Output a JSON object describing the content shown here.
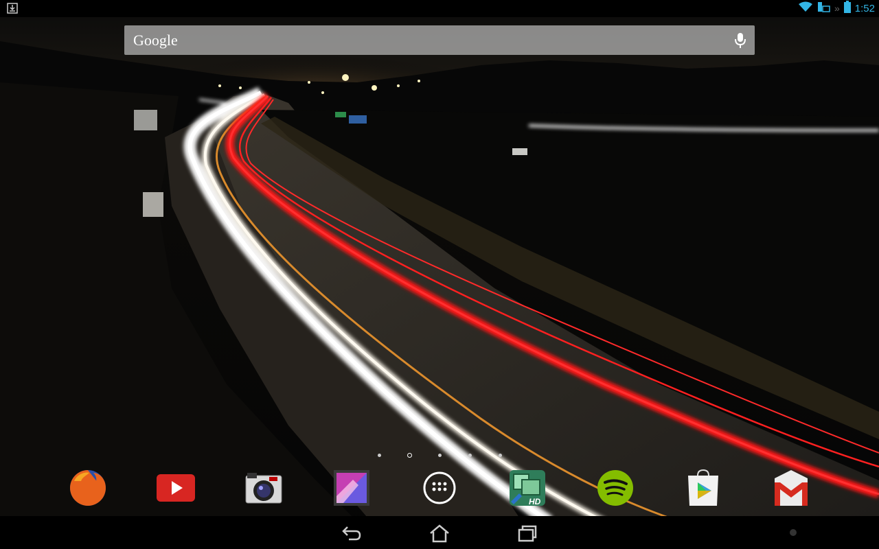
{
  "status_bar": {
    "time": "1:52",
    "icons": [
      "download-notification-icon",
      "wifi-icon",
      "keyboard-icon",
      "battery-icon"
    ]
  },
  "search": {
    "logo_text": "Google",
    "icon": "mic-icon"
  },
  "home": {
    "page_count": 5,
    "current_page": 2
  },
  "dock": {
    "apps": [
      {
        "name": "firefox",
        "icon": "firefox-icon"
      },
      {
        "name": "youtube",
        "icon": "youtube-icon"
      },
      {
        "name": "camera",
        "icon": "camera-icon"
      },
      {
        "name": "gallery",
        "icon": "gallery-icon"
      },
      {
        "name": "all-apps",
        "icon": "apps-grid-icon"
      },
      {
        "name": "screen-tools-hd",
        "icon": "screen-tools-icon",
        "badge": "HD"
      },
      {
        "name": "spotify",
        "icon": "spotify-icon"
      },
      {
        "name": "play-store",
        "icon": "play-store-icon"
      },
      {
        "name": "gmail",
        "icon": "gmail-icon"
      }
    ]
  },
  "nav_bar": {
    "buttons": [
      "back-icon",
      "home-icon",
      "recents-icon"
    ]
  },
  "colors": {
    "accent": "#33b5e5",
    "wallpaper_light_trail_red": "#ff2020",
    "wallpaper_light_trail_white": "#ffffff"
  }
}
